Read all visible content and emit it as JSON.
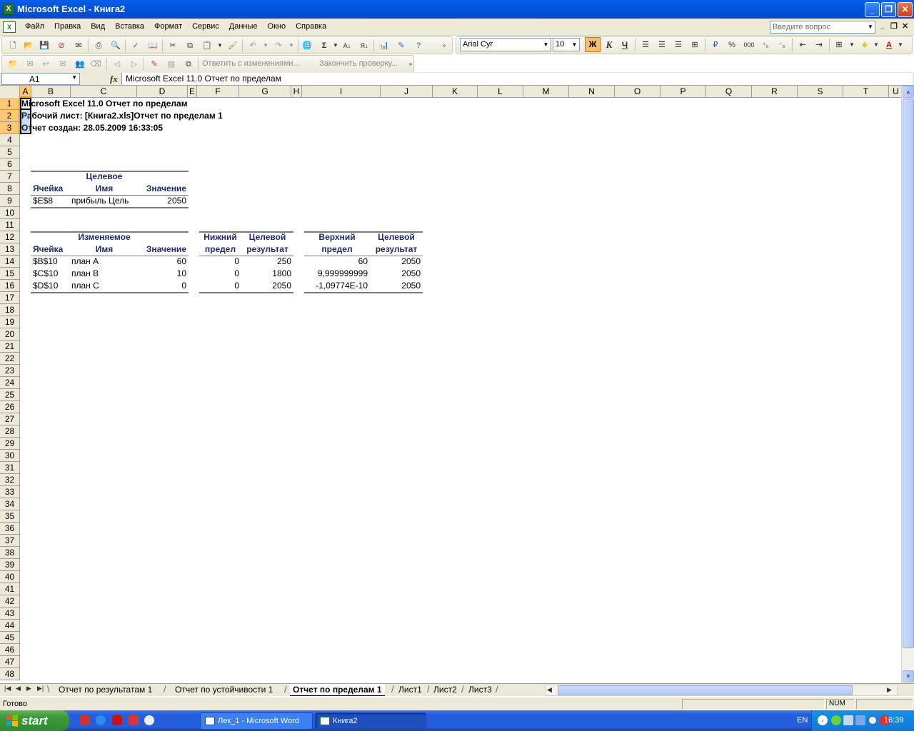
{
  "window": {
    "title": "Microsoft Excel - Книга2",
    "app_icon": "excel-icon",
    "controls": [
      "minimize",
      "restore",
      "close"
    ]
  },
  "menubar": {
    "items": [
      "Файл",
      "Правка",
      "Вид",
      "Вставка",
      "Формат",
      "Сервис",
      "Данные",
      "Окно",
      "Справка"
    ],
    "ask_placeholder": "Введите вопрос"
  },
  "toolbar": {
    "font_name": "Arial Cyr",
    "font_size": "10",
    "bold_label": "Ж",
    "italic_label": "К",
    "underline_label": "Ч",
    "percent_label": "%",
    "thousands_label": "000",
    "review_reply": "Ответить с изменениями...",
    "review_end": "Закончить проверку..."
  },
  "formula_bar": {
    "name_box": "A1",
    "fx_label": "fx",
    "formula": "Microsoft Excel 11.0 Отчет по пределам"
  },
  "columns": [
    "A",
    "B",
    "C",
    "D",
    "E",
    "F",
    "G",
    "H",
    "I",
    "J",
    "K",
    "L",
    "M",
    "N",
    "O",
    "P",
    "Q",
    "R",
    "S",
    "T",
    "U"
  ],
  "rows": [
    1,
    2,
    3,
    4,
    5,
    6,
    7,
    8,
    9,
    10,
    11,
    12,
    13,
    14,
    15,
    16,
    17,
    18,
    19,
    20,
    21,
    22,
    23,
    24,
    25,
    26,
    27,
    28,
    29,
    30,
    31,
    32,
    33,
    34,
    35,
    36,
    37,
    38,
    39,
    40,
    41,
    42,
    43,
    44,
    45,
    46,
    47,
    48
  ],
  "sheet": {
    "r1": "Microsoft Excel 11.0 Отчет по пределам",
    "r2": "Рабочий лист: [Книга2.xls]Отчет по пределам 1",
    "r3": "Отчет создан: 28.05.2009 16:33:05",
    "target": {
      "title": "Целевое",
      "h_cell": "Ячейка",
      "h_name": "Имя",
      "h_value": "Значение",
      "cell": "$E$8",
      "name": "прибыль Цель",
      "value": "2050"
    },
    "variable": {
      "title": "Изменяемое",
      "h_cell": "Ячейка",
      "h_name": "Имя",
      "h_value": "Значение",
      "h_lower_1": "Нижний",
      "h_lower_2": "предел",
      "h_tres_1": "Целевой",
      "h_tres_2": "результат",
      "h_upper_1": "Верхний",
      "h_upper_2": "предел",
      "h_tres2_1": "Целевой",
      "h_tres2_2": "результат",
      "rows": [
        {
          "cell": "$B$10",
          "name": "план A",
          "value": "60",
          "lower": "0",
          "lower_res": "250",
          "upper": "60",
          "upper_res": "2050"
        },
        {
          "cell": "$C$10",
          "name": "план B",
          "value": "10",
          "lower": "0",
          "lower_res": "1800",
          "upper": "9,999999999",
          "upper_res": "2050"
        },
        {
          "cell": "$D$10",
          "name": "план C",
          "value": "0",
          "lower": "0",
          "lower_res": "2050",
          "upper": "-1,09774E-10",
          "upper_res": "2050"
        }
      ]
    }
  },
  "tabs": [
    "Отчет по результатам 1",
    "Отчет по устойчивости 1",
    "Отчет по пределам 1",
    "Лист1",
    "Лист2",
    "Лист3"
  ],
  "active_tab": "Отчет по пределам 1",
  "status": {
    "text": "Готово",
    "num": "NUM"
  },
  "taskbar": {
    "start": "start",
    "tasks": [
      "Лек_1 - Microsoft Word",
      "Книга2"
    ],
    "lang": "EN",
    "clock": "16:39"
  }
}
